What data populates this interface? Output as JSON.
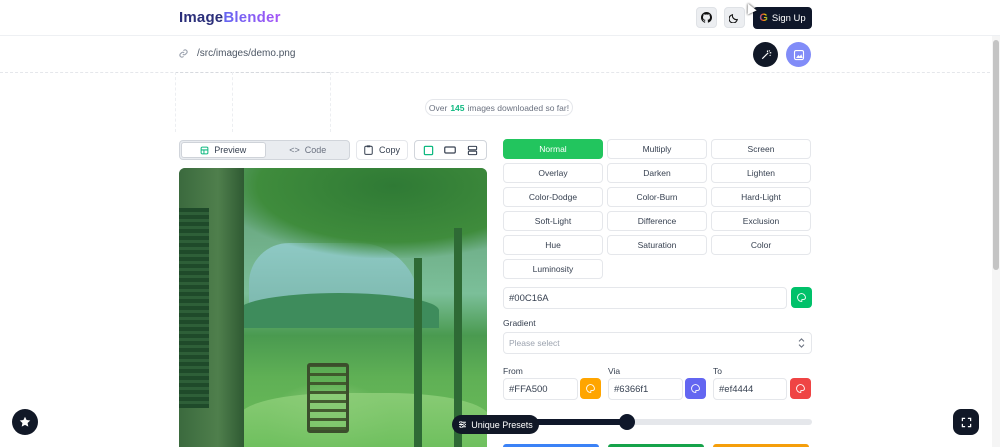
{
  "header": {
    "logo_part1": "Image",
    "logo_part2": "Blender",
    "github_icon": "github-icon",
    "theme_icon": "moon-icon",
    "signup_label": "Sign Up"
  },
  "url_bar": {
    "path": "/src/images/demo.png",
    "magic_icon": "magic-wand-icon",
    "image_icon": "image-icon"
  },
  "counter": {
    "prefix": "Over",
    "count": "145",
    "suffix": "images downloaded so far!"
  },
  "preview_panel": {
    "tabs": [
      {
        "label": "Preview",
        "active": true
      },
      {
        "label": "Code",
        "active": false
      }
    ],
    "copy_label": "Copy"
  },
  "blend_modes": [
    {
      "label": "Normal",
      "active": true
    },
    {
      "label": "Multiply"
    },
    {
      "label": "Screen"
    },
    {
      "label": "Overlay"
    },
    {
      "label": "Darken"
    },
    {
      "label": "Lighten"
    },
    {
      "label": "Color-Dodge"
    },
    {
      "label": "Color-Burn"
    },
    {
      "label": "Hard-Light"
    },
    {
      "label": "Soft-Light"
    },
    {
      "label": "Difference"
    },
    {
      "label": "Exclusion"
    },
    {
      "label": "Hue"
    },
    {
      "label": "Saturation"
    },
    {
      "label": "Color"
    },
    {
      "label": "Luminosity"
    }
  ],
  "color": {
    "value": "#00C16A",
    "swatch": "#00c16a"
  },
  "gradient": {
    "label": "Gradient",
    "placeholder": "Please select",
    "from_label": "From",
    "from_value": "#FFA500",
    "from_color": "#ffa500",
    "via_label": "Via",
    "via_value": "#6366f1",
    "via_color": "#6366f1",
    "to_label": "To",
    "to_value": "#ef4444",
    "to_color": "#ef4444"
  },
  "opacity_slider": {
    "value": 0.4
  },
  "presets_label": "Unique Presets"
}
